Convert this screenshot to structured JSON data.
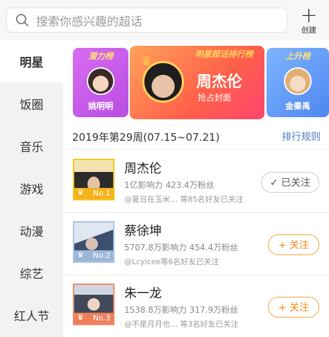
{
  "search": {
    "placeholder": "搜索你感兴趣的超话"
  },
  "create": {
    "label": "创建"
  },
  "sidebar": {
    "items": [
      {
        "label": "明星",
        "active": true
      },
      {
        "label": "饭圈"
      },
      {
        "label": "音乐"
      },
      {
        "label": "游戏"
      },
      {
        "label": "动漫"
      },
      {
        "label": "综艺"
      },
      {
        "label": "红人节"
      }
    ]
  },
  "banners": {
    "left": {
      "tag": "潜力榜",
      "name": "姚明明"
    },
    "mid": {
      "tag": "明星超话排行榜",
      "name": "周杰伦",
      "sub": "抢占封面"
    },
    "right": {
      "tag": "上升榜",
      "name": "金秦禹"
    }
  },
  "week": {
    "label": "2019年第29周(07.15~07.21)",
    "rule": "排行规则"
  },
  "rows": [
    {
      "name": "周杰伦",
      "stats": "1亿影响力 423.4万粉丝",
      "friends": "@夏日在玉米…  等85名好友已关注",
      "rank": "No.1",
      "action": "✓ 已关注",
      "followed": true
    },
    {
      "name": "蔡徐坤",
      "stats": "5707.8万影响力 454.4万粉丝",
      "friends": "@Lcyicee等6名好友已关注",
      "rank": "No.2",
      "action": "+ 关注",
      "followed": false
    },
    {
      "name": "朱一龙",
      "stats": "1538.8万影响力 317.9万粉丝",
      "friends": "@不是月月也…  等3名好友已关注",
      "rank": "No.3",
      "action": "+ 关注",
      "followed": false
    }
  ],
  "colors": {
    "accent": "#f08a14",
    "link": "#4a7bc6",
    "gold": "#f5c518"
  }
}
